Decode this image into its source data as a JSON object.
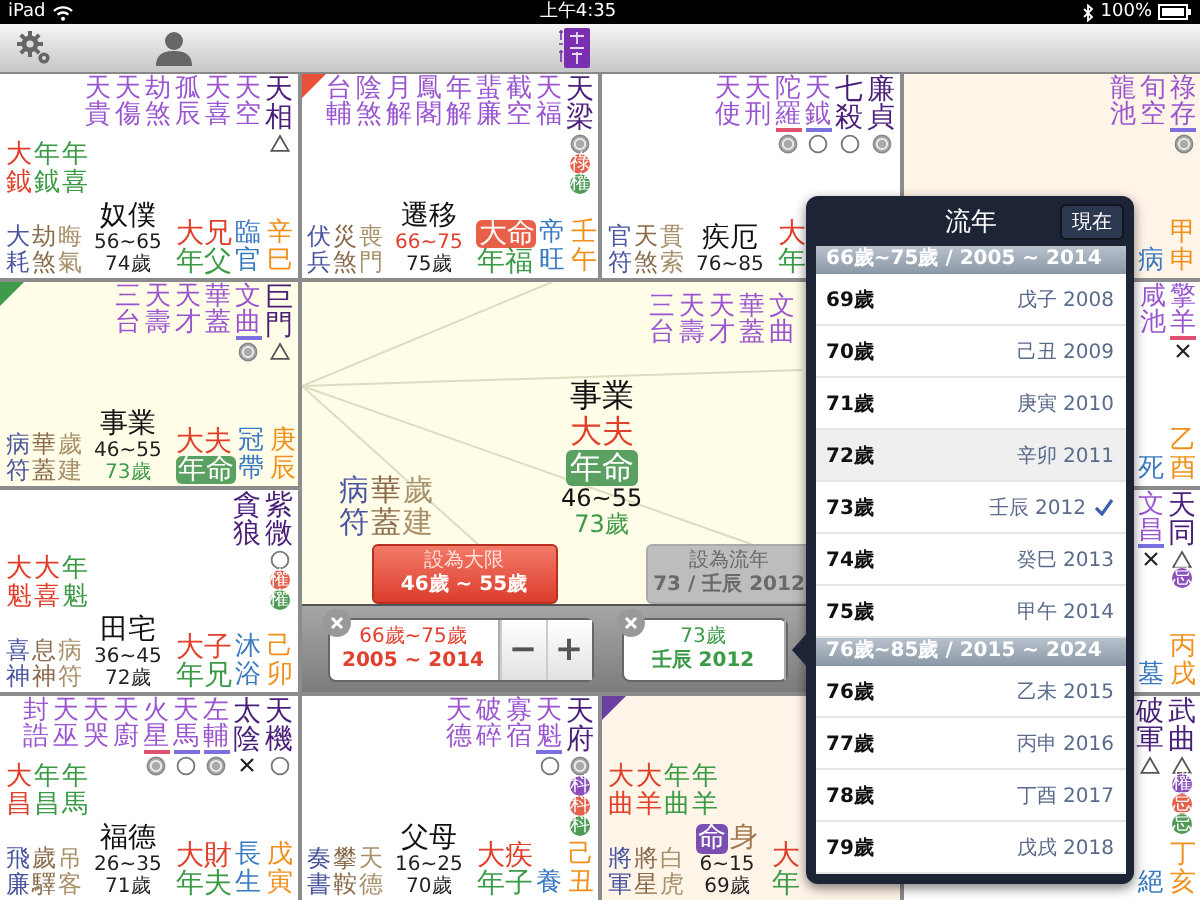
{
  "status_bar": {
    "device": "iPad",
    "time": "上午4:35",
    "battery": "100%"
  },
  "palaces": [
    {
      "stars": [
        {
          "text": "天貴",
          "kind": "minor"
        },
        {
          "text": "天傷",
          "kind": "minor"
        },
        {
          "text": "劫煞",
          "kind": "minor"
        },
        {
          "text": "孤辰",
          "kind": "minor"
        },
        {
          "text": "天喜",
          "kind": "minor"
        },
        {
          "text": "天空",
          "kind": "minor"
        },
        {
          "text": "天相",
          "kind": "main",
          "marks": [
            {
              "kind": "triangle"
            }
          ]
        }
      ],
      "extras": [
        {
          "text": "大鉞",
          "kind": "da"
        },
        {
          "text": "年鉞",
          "kind": "nian"
        },
        {
          "text": "年喜",
          "kind": "nian"
        }
      ],
      "gods": [
        "大耗",
        "劫煞",
        "晦氣"
      ],
      "name": "奴僕",
      "range": "56~65",
      "range_current": false,
      "age": "74歲",
      "age_current": false,
      "da": {
        "text": "大兄",
        "badge": false
      },
      "nian": {
        "text": "年父",
        "badge": false
      },
      "changsheng": "臨官",
      "ganzhi": "辛巳"
    },
    {
      "corner": {
        "color": "#e8503a"
      },
      "stars": [
        {
          "text": "台輔",
          "kind": "minor"
        },
        {
          "text": "陰煞",
          "kind": "minor"
        },
        {
          "text": "月解",
          "kind": "minor"
        },
        {
          "text": "鳳閣",
          "kind": "minor"
        },
        {
          "text": "年解",
          "kind": "minor"
        },
        {
          "text": "蜚廉",
          "kind": "minor"
        },
        {
          "text": "截空",
          "kind": "minor"
        },
        {
          "text": "天福",
          "kind": "minor"
        },
        {
          "text": "天梁",
          "kind": "main",
          "marks": [
            {
              "kind": "ring"
            },
            {
              "kind": "badge",
              "text": "祿",
              "color": "#e2604c"
            },
            {
              "kind": "badge",
              "text": "權",
              "color": "#4f9a55"
            }
          ]
        }
      ],
      "gods": [
        "伏兵",
        "災煞",
        "喪門"
      ],
      "name": "遷移",
      "range": "66~75",
      "range_current": true,
      "age": "75歲",
      "age_current": false,
      "da": {
        "text": "大命",
        "badge": true
      },
      "nian": {
        "text": "年福",
        "badge": false
      },
      "changsheng": "帝旺",
      "ganzhi": "壬午"
    },
    {
      "stars": [
        {
          "text": "天使",
          "kind": "minor"
        },
        {
          "text": "天刑",
          "kind": "minor"
        },
        {
          "text": "陀羅",
          "kind": "minor",
          "underline": {
            "color": "#e05070"
          },
          "marks": [
            {
              "kind": "ring"
            }
          ]
        },
        {
          "text": "天鉞",
          "kind": "minor",
          "underline": {
            "color": "#7a70e0"
          },
          "marks": [
            {
              "kind": "circle"
            }
          ]
        },
        {
          "text": "七殺",
          "kind": "main",
          "marks": [
            {
              "kind": "circle"
            }
          ]
        },
        {
          "text": "廉貞",
          "kind": "main",
          "marks": [
            {
              "kind": "ring"
            }
          ]
        }
      ],
      "gods": [
        "官符",
        "天煞",
        "貫索"
      ],
      "name": "疾厄",
      "range": "76~85",
      "range_current": false,
      "da": {
        "text": "大",
        "badge": false
      },
      "nian": {
        "text": "年",
        "badge": false
      }
    },
    {
      "tint": {
        "color": "#fff4e8"
      },
      "stars": [
        {
          "text": "龍池",
          "kind": "minor"
        },
        {
          "text": "旬空",
          "kind": "minor"
        },
        {
          "text": "祿存",
          "kind": "minor",
          "underline": {
            "color": "#7a70e0"
          },
          "marks": [
            {
              "kind": "ring"
            }
          ]
        }
      ],
      "changsheng": "病",
      "ganzhi": "甲申"
    },
    {
      "tint": {
        "color": "#fffce8"
      },
      "corner": {
        "color": "#3f9a4a"
      },
      "stars": [
        {
          "text": "三台",
          "kind": "minor"
        },
        {
          "text": "天壽",
          "kind": "minor"
        },
        {
          "text": "天才",
          "kind": "minor"
        },
        {
          "text": "華蓋",
          "kind": "minor"
        },
        {
          "text": "文曲",
          "kind": "minor",
          "underline": {
            "color": "#7a70e0"
          },
          "marks": [
            {
              "kind": "ring"
            }
          ]
        },
        {
          "text": "巨門",
          "kind": "main",
          "marks": [
            {
              "kind": "triangle"
            }
          ]
        }
      ],
      "gods": [
        "病符",
        "華蓋",
        "歲建"
      ],
      "name": "事業",
      "range": "46~55",
      "range_current": false,
      "age": "73歲",
      "age_current": true,
      "da": {
        "text": "大夫",
        "badge": false
      },
      "nian": {
        "text": "年命",
        "badge": true
      },
      "changsheng": "冠帶",
      "ganzhi": "庚辰"
    },
    {
      "stars": [
        {
          "text": "咸池",
          "kind": "minor"
        },
        {
          "text": "擎羊",
          "kind": "minor",
          "underline": {
            "color": "#e05070"
          },
          "marks": [
            {
              "kind": "cross"
            }
          ]
        }
      ],
      "changsheng": "死",
      "ganzhi": "乙酉"
    },
    {
      "stars": [
        {
          "text": "貪狼",
          "kind": "main"
        },
        {
          "text": "紫微",
          "kind": "main",
          "marks": [
            {
              "kind": "circle"
            },
            {
              "kind": "badge",
              "text": "權",
              "color": "#e2604c"
            },
            {
              "kind": "badge",
              "text": "權",
              "color": "#4f9a55"
            }
          ]
        }
      ],
      "extras": [
        {
          "text": "大魁",
          "kind": "da"
        },
        {
          "text": "大喜",
          "kind": "da"
        },
        {
          "text": "年魁",
          "kind": "nian"
        }
      ],
      "gods": [
        "喜神",
        "息神",
        "病符"
      ],
      "name": "田宅",
      "range": "36~45",
      "range_current": false,
      "age": "72歲",
      "age_current": false,
      "da": {
        "text": "大子",
        "badge": false
      },
      "nian": {
        "text": "年兄",
        "badge": false
      },
      "changsheng": "沐浴",
      "ganzhi": "己卯"
    },
    {
      "stars": [
        {
          "text": "文昌",
          "kind": "minor",
          "underline": {
            "color": "#7a70e0"
          },
          "marks": [
            {
              "kind": "cross"
            }
          ]
        },
        {
          "text": "天同",
          "kind": "main",
          "marks": [
            {
              "kind": "triangle"
            },
            {
              "kind": "badge",
              "text": "忌",
              "color": "#8a4fb8"
            }
          ]
        }
      ],
      "changsheng": "墓",
      "ganzhi": "丙戌"
    },
    {
      "stars": [
        {
          "text": "封誥",
          "kind": "minor"
        },
        {
          "text": "天巫",
          "kind": "minor"
        },
        {
          "text": "天哭",
          "kind": "minor"
        },
        {
          "text": "天廚",
          "kind": "minor"
        },
        {
          "text": "火星",
          "kind": "minor",
          "underline": {
            "color": "#e05070"
          },
          "marks": [
            {
              "kind": "ring"
            }
          ]
        },
        {
          "text": "天馬",
          "kind": "minor",
          "underline": {
            "color": "#7a70e0"
          },
          "marks": [
            {
              "kind": "circle"
            }
          ]
        },
        {
          "text": "左輔",
          "kind": "minor",
          "underline": {
            "color": "#7a70e0"
          },
          "marks": [
            {
              "kind": "ring"
            }
          ]
        },
        {
          "text": "太陰",
          "kind": "main",
          "marks": [
            {
              "kind": "cross"
            }
          ]
        },
        {
          "text": "天機",
          "kind": "main",
          "marks": [
            {
              "kind": "circle"
            }
          ]
        }
      ],
      "extras": [
        {
          "text": "大昌",
          "kind": "da"
        },
        {
          "text": "年昌",
          "kind": "nian"
        },
        {
          "text": "年馬",
          "kind": "nian"
        }
      ],
      "gods": [
        "飛廉",
        "歲驛",
        "吊客"
      ],
      "name": "福德",
      "range": "26~35",
      "range_current": false,
      "age": "71歲",
      "age_current": false,
      "da": {
        "text": "大財",
        "badge": false
      },
      "nian": {
        "text": "年夫",
        "badge": false
      },
      "changsheng": "長生",
      "ganzhi": "戊寅"
    },
    {
      "stars": [
        {
          "text": "天德",
          "kind": "minor"
        },
        {
          "text": "破碎",
          "kind": "minor"
        },
        {
          "text": "寡宿",
          "kind": "minor"
        },
        {
          "text": "天魁",
          "kind": "minor",
          "underline": {
            "color": "#7a70e0"
          },
          "marks": [
            {
              "kind": "circle"
            }
          ]
        },
        {
          "text": "天府",
          "kind": "main",
          "marks": [
            {
              "kind": "ring"
            },
            {
              "kind": "badge",
              "text": "科",
              "color": "#8a4fb8"
            },
            {
              "kind": "badge",
              "text": "科",
              "color": "#e2604c"
            },
            {
              "kind": "badge",
              "text": "科",
              "color": "#4f9a55"
            }
          ]
        }
      ],
      "gods": [
        "奏書",
        "攀鞍",
        "天德"
      ],
      "name": "父母",
      "range": "16~25",
      "range_current": false,
      "age": "70歲",
      "age_current": false,
      "da": {
        "text": "大疾",
        "badge": false
      },
      "nian": {
        "text": "年子",
        "badge": false
      },
      "changsheng": "養",
      "ganzhi": "己丑"
    },
    {
      "tint": {
        "color": "#fff4e8"
      },
      "corner": {
        "color": "#6a3fa0"
      },
      "extras": [
        {
          "text": "大曲",
          "kind": "da"
        },
        {
          "text": "大羊",
          "kind": "da"
        },
        {
          "text": "年曲",
          "kind": "nian"
        },
        {
          "text": "年羊",
          "kind": "nian"
        }
      ],
      "gods": [
        "將軍",
        "將星",
        "白虎"
      ],
      "name": "命",
      "name_badge": true,
      "body": "身",
      "range": "6~15",
      "range_current": false,
      "age": "69歲",
      "age_current": false,
      "da": {
        "text": "大",
        "badge": false
      },
      "nian": {
        "text": "年",
        "badge": false
      }
    },
    {
      "stars": [
        {
          "text": "破軍",
          "kind": "main",
          "marks": [
            {
              "kind": "triangle"
            }
          ]
        },
        {
          "text": "武曲",
          "kind": "main",
          "marks": [
            {
              "kind": "triangle"
            },
            {
              "kind": "badge",
              "text": "權",
              "color": "#8a4fb8"
            },
            {
              "kind": "badge",
              "text": "忌",
              "color": "#e2604c"
            },
            {
              "kind": "badge",
              "text": "忌",
              "color": "#4f9a55"
            }
          ]
        }
      ],
      "changsheng": "絕",
      "ganzhi": "丁亥"
    }
  ],
  "center": {
    "stars": [
      "三台",
      "天壽",
      "天才",
      "華蓋",
      "文曲"
    ],
    "gods": [
      "病符",
      "華蓋",
      "歲建"
    ],
    "name": "事業",
    "da": "大夫",
    "nian": "年命",
    "range": "46~55",
    "age": "73歲",
    "buttons": [
      {
        "label": "設為大限",
        "detail": "46歲 ~ 55歲",
        "disabled": false
      },
      {
        "label": "設為流年",
        "detail": "73 / 壬辰 2012",
        "disabled": true
      }
    ],
    "decade_control": {
      "line1": "66歲~75歲",
      "line2": "2005 ~ 2014",
      "minus": "−",
      "plus": "+"
    },
    "year_control": {
      "line1": "73歲",
      "line2": "壬辰 2012"
    }
  },
  "year_popover": {
    "title": "流年",
    "now_button": "現在",
    "sections": [
      {
        "header": "66歲~75歲 / 2005 ~ 2014",
        "rows": [
          {
            "age": "69歲",
            "year": "戊子 2008",
            "selected": false,
            "highlighted": false
          },
          {
            "age": "70歲",
            "year": "己丑 2009",
            "selected": false,
            "highlighted": false
          },
          {
            "age": "71歲",
            "year": "庚寅 2010",
            "selected": false,
            "highlighted": false
          },
          {
            "age": "72歲",
            "year": "辛卯 2011",
            "selected": false,
            "highlighted": true
          },
          {
            "age": "73歲",
            "year": "壬辰 2012",
            "selected": true,
            "highlighted": false
          },
          {
            "age": "74歲",
            "year": "癸巳 2013",
            "selected": false,
            "highlighted": false
          },
          {
            "age": "75歲",
            "year": "甲午 2014",
            "selected": false,
            "highlighted": false
          }
        ]
      },
      {
        "header": "76歲~85歲 / 2015 ~ 2024",
        "rows": [
          {
            "age": "76歲",
            "year": "乙未 2015",
            "selected": false,
            "highlighted": false
          },
          {
            "age": "77歲",
            "year": "丙申 2016",
            "selected": false,
            "highlighted": false
          },
          {
            "age": "78歲",
            "year": "丁酉 2017",
            "selected": false,
            "highlighted": false
          },
          {
            "age": "79歲",
            "year": "戊戌 2018",
            "selected": false,
            "highlighted": false
          }
        ]
      }
    ]
  }
}
